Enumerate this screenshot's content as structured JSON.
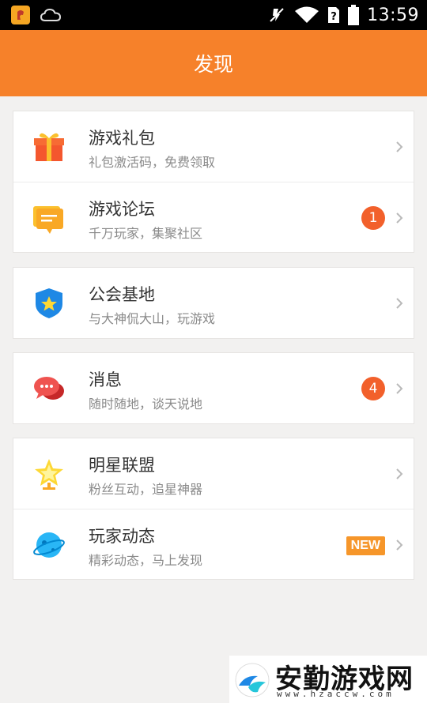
{
  "status_bar": {
    "time": "13:59",
    "icons": [
      "app-notification-icon",
      "cloud-icon",
      "mute-icon",
      "wifi-icon",
      "sim-icon",
      "battery-icon"
    ]
  },
  "app_bar": {
    "title": "发现"
  },
  "groups": [
    {
      "items": [
        {
          "title": "游戏礼包",
          "subtitle": "礼包激活码，免费领取",
          "icon": "gift-icon"
        },
        {
          "title": "游戏论坛",
          "subtitle": "千万玩家，集聚社区",
          "icon": "forum-icon",
          "badge": "1"
        }
      ]
    },
    {
      "items": [
        {
          "title": "公会基地",
          "subtitle": "与大神侃大山，玩游戏",
          "icon": "shield-icon"
        }
      ]
    },
    {
      "items": [
        {
          "title": "消息",
          "subtitle": "随时随地，谈天说地",
          "icon": "chat-icon",
          "badge": "4"
        }
      ]
    },
    {
      "items": [
        {
          "title": "明星联盟",
          "subtitle": "粉丝互动，追星神器",
          "icon": "star-trophy-icon"
        },
        {
          "title": "玩家动态",
          "subtitle": "精彩动态，马上发现",
          "icon": "planet-icon",
          "tag": "NEW"
        }
      ]
    }
  ],
  "watermark": {
    "text": "安勤游戏网",
    "url": "www.hzaccw.com"
  },
  "colors": {
    "accent": "#f6812a",
    "badge": "#f2602b",
    "new_tag": "#f6962a"
  }
}
